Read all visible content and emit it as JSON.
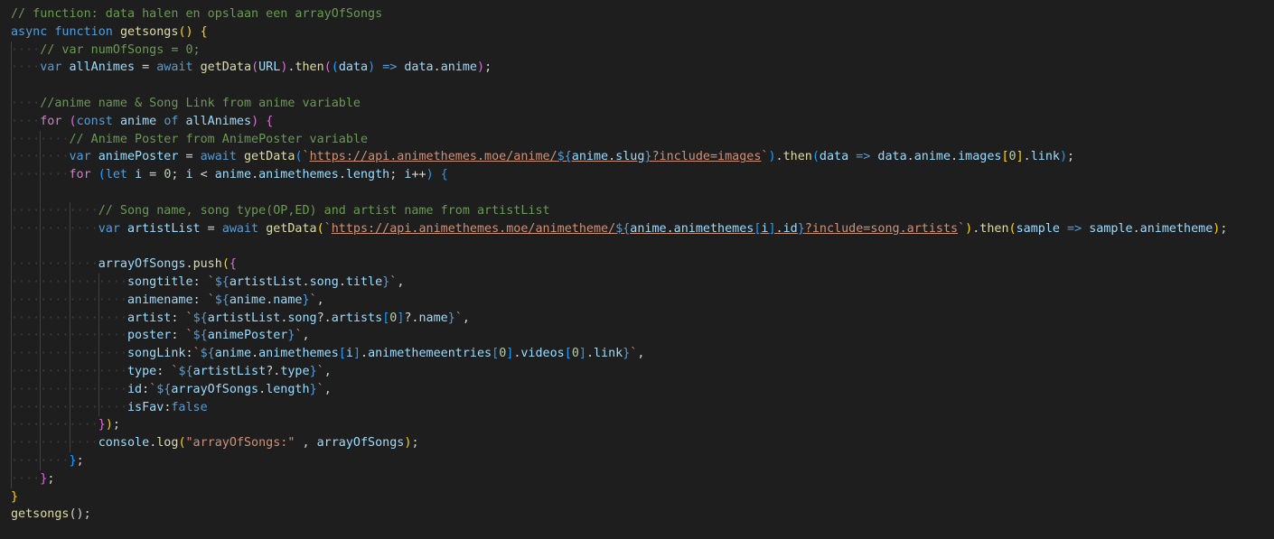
{
  "editor": {
    "lines": [
      [
        {
          "t": "// function: data halen en opslaan een arrayOfSongs",
          "c": "c"
        }
      ],
      [
        {
          "t": "async",
          "c": "k"
        },
        {
          "t": " "
        },
        {
          "t": "function",
          "c": "k"
        },
        {
          "t": " "
        },
        {
          "t": "getsongs",
          "c": "f"
        },
        {
          "t": "()",
          "c": "b1"
        },
        {
          "t": " "
        },
        {
          "t": "{",
          "c": "b1"
        }
      ],
      [
        {
          "t": "····",
          "c": "ws"
        },
        {
          "t": "// var numOfSongs = 0;",
          "c": "c"
        }
      ],
      [
        {
          "t": "····",
          "c": "ws"
        },
        {
          "t": "var",
          "c": "k"
        },
        {
          "t": " "
        },
        {
          "t": "allAnimes",
          "c": "v"
        },
        {
          "t": " = "
        },
        {
          "t": "await",
          "c": "k"
        },
        {
          "t": " "
        },
        {
          "t": "getData",
          "c": "f"
        },
        {
          "t": "(",
          "c": "b2"
        },
        {
          "t": "URL",
          "c": "v"
        },
        {
          "t": ")",
          "c": "b2"
        },
        {
          "t": "."
        },
        {
          "t": "then",
          "c": "f"
        },
        {
          "t": "(",
          "c": "b2"
        },
        {
          "t": "(",
          "c": "b3"
        },
        {
          "t": "data",
          "c": "v"
        },
        {
          "t": ")",
          "c": "b3"
        },
        {
          "t": " "
        },
        {
          "t": "=>",
          "c": "k"
        },
        {
          "t": " "
        },
        {
          "t": "data",
          "c": "v"
        },
        {
          "t": "."
        },
        {
          "t": "anime",
          "c": "v"
        },
        {
          "t": ")",
          "c": "b2"
        },
        {
          "t": ";"
        }
      ],
      [],
      [
        {
          "t": "····",
          "c": "ws"
        },
        {
          "t": "//anime name & Song Link from anime variable",
          "c": "c"
        }
      ],
      [
        {
          "t": "····",
          "c": "ws"
        },
        {
          "t": "for",
          "c": "k2"
        },
        {
          "t": " "
        },
        {
          "t": "(",
          "c": "b2"
        },
        {
          "t": "const",
          "c": "k"
        },
        {
          "t": " "
        },
        {
          "t": "anime",
          "c": "v"
        },
        {
          "t": " "
        },
        {
          "t": "of",
          "c": "k"
        },
        {
          "t": " "
        },
        {
          "t": "allAnimes",
          "c": "v"
        },
        {
          "t": ")",
          "c": "b2"
        },
        {
          "t": " "
        },
        {
          "t": "{",
          "c": "b2"
        }
      ],
      [
        {
          "t": "········",
          "c": "ws"
        },
        {
          "t": "// Anime Poster from AnimePoster variable",
          "c": "c"
        }
      ],
      [
        {
          "t": "········",
          "c": "ws"
        },
        {
          "t": "var",
          "c": "k"
        },
        {
          "t": " "
        },
        {
          "t": "animePoster",
          "c": "v"
        },
        {
          "t": " = "
        },
        {
          "t": "await",
          "c": "k"
        },
        {
          "t": " "
        },
        {
          "t": "getData",
          "c": "f"
        },
        {
          "t": "(",
          "c": "b3"
        },
        {
          "t": "`",
          "c": "s"
        },
        {
          "t": "https://api.animethemes.moe/anime/",
          "c": "s",
          "u": true
        },
        {
          "t": "${",
          "c": "k",
          "u": true
        },
        {
          "t": "anime",
          "c": "v",
          "u": true
        },
        {
          "t": ".",
          "c": "o",
          "u": true
        },
        {
          "t": "slug",
          "c": "v",
          "u": true
        },
        {
          "t": "}",
          "c": "k",
          "u": true
        },
        {
          "t": "?include=images",
          "c": "s",
          "u": true
        },
        {
          "t": "`",
          "c": "s"
        },
        {
          "t": ")",
          "c": "b3"
        },
        {
          "t": "."
        },
        {
          "t": "then",
          "c": "f"
        },
        {
          "t": "(",
          "c": "b3"
        },
        {
          "t": "data",
          "c": "v"
        },
        {
          "t": " "
        },
        {
          "t": "=>",
          "c": "k"
        },
        {
          "t": " "
        },
        {
          "t": "data",
          "c": "v"
        },
        {
          "t": "."
        },
        {
          "t": "anime",
          "c": "v"
        },
        {
          "t": "."
        },
        {
          "t": "images",
          "c": "v"
        },
        {
          "t": "[",
          "c": "b1"
        },
        {
          "t": "0",
          "c": "n"
        },
        {
          "t": "]",
          "c": "b1"
        },
        {
          "t": "."
        },
        {
          "t": "link",
          "c": "v"
        },
        {
          "t": ")",
          "c": "b3"
        },
        {
          "t": ";"
        }
      ],
      [
        {
          "t": "········",
          "c": "ws"
        },
        {
          "t": "for",
          "c": "k2"
        },
        {
          "t": " "
        },
        {
          "t": "(",
          "c": "b3"
        },
        {
          "t": "let",
          "c": "k"
        },
        {
          "t": " "
        },
        {
          "t": "i",
          "c": "v"
        },
        {
          "t": " = "
        },
        {
          "t": "0",
          "c": "n"
        },
        {
          "t": "; "
        },
        {
          "t": "i",
          "c": "v"
        },
        {
          "t": " < "
        },
        {
          "t": "anime",
          "c": "v"
        },
        {
          "t": "."
        },
        {
          "t": "animethemes",
          "c": "v"
        },
        {
          "t": "."
        },
        {
          "t": "length",
          "c": "v"
        },
        {
          "t": "; "
        },
        {
          "t": "i",
          "c": "v"
        },
        {
          "t": "++"
        },
        {
          "t": ")",
          "c": "b3"
        },
        {
          "t": " "
        },
        {
          "t": "{",
          "c": "b3"
        }
      ],
      [],
      [
        {
          "t": "············",
          "c": "ws"
        },
        {
          "t": "// Song name, song type(OP,ED) and artist name from artistList",
          "c": "c"
        }
      ],
      [
        {
          "t": "············",
          "c": "ws"
        },
        {
          "t": "var",
          "c": "k"
        },
        {
          "t": " "
        },
        {
          "t": "artistList",
          "c": "v"
        },
        {
          "t": " = "
        },
        {
          "t": "await",
          "c": "k"
        },
        {
          "t": " "
        },
        {
          "t": "getData",
          "c": "f"
        },
        {
          "t": "(",
          "c": "b1"
        },
        {
          "t": "`",
          "c": "s"
        },
        {
          "t": "https://api.animethemes.moe/animetheme/",
          "c": "s",
          "u": true
        },
        {
          "t": "${",
          "c": "k",
          "u": true
        },
        {
          "t": "anime",
          "c": "v",
          "u": true
        },
        {
          "t": ".",
          "c": "o",
          "u": true
        },
        {
          "t": "animethemes",
          "c": "v",
          "u": true
        },
        {
          "t": "[",
          "c": "b3",
          "u": true
        },
        {
          "t": "i",
          "c": "v",
          "u": true
        },
        {
          "t": "]",
          "c": "b3",
          "u": true
        },
        {
          "t": ".",
          "c": "o",
          "u": true
        },
        {
          "t": "id",
          "c": "v",
          "u": true
        },
        {
          "t": "}",
          "c": "k",
          "u": true
        },
        {
          "t": "?include=song.artists",
          "c": "s",
          "u": true
        },
        {
          "t": "`",
          "c": "s"
        },
        {
          "t": ")",
          "c": "b1"
        },
        {
          "t": "."
        },
        {
          "t": "then",
          "c": "f"
        },
        {
          "t": "(",
          "c": "b1"
        },
        {
          "t": "sample",
          "c": "v"
        },
        {
          "t": " "
        },
        {
          "t": "=>",
          "c": "k"
        },
        {
          "t": " "
        },
        {
          "t": "sample",
          "c": "v"
        },
        {
          "t": "."
        },
        {
          "t": "animetheme",
          "c": "v"
        },
        {
          "t": ")",
          "c": "b1"
        },
        {
          "t": ";"
        }
      ],
      [],
      [
        {
          "t": "············",
          "c": "ws"
        },
        {
          "t": "arrayOfSongs",
          "c": "v"
        },
        {
          "t": "."
        },
        {
          "t": "push",
          "c": "f"
        },
        {
          "t": "(",
          "c": "b1"
        },
        {
          "t": "{",
          "c": "b2"
        }
      ],
      [
        {
          "t": "················",
          "c": "ws"
        },
        {
          "t": "songtitle",
          "c": "v"
        },
        {
          "t": ": "
        },
        {
          "t": "`",
          "c": "s"
        },
        {
          "t": "${",
          "c": "k"
        },
        {
          "t": "artistList",
          "c": "v"
        },
        {
          "t": "."
        },
        {
          "t": "song",
          "c": "v"
        },
        {
          "t": "."
        },
        {
          "t": "title",
          "c": "v"
        },
        {
          "t": "}",
          "c": "k"
        },
        {
          "t": "`",
          "c": "s"
        },
        {
          "t": ","
        }
      ],
      [
        {
          "t": "················",
          "c": "ws"
        },
        {
          "t": "animename",
          "c": "v"
        },
        {
          "t": ": "
        },
        {
          "t": "`",
          "c": "s"
        },
        {
          "t": "${",
          "c": "k"
        },
        {
          "t": "anime",
          "c": "v"
        },
        {
          "t": "."
        },
        {
          "t": "name",
          "c": "v"
        },
        {
          "t": "}",
          "c": "k"
        },
        {
          "t": "`",
          "c": "s"
        },
        {
          "t": ","
        }
      ],
      [
        {
          "t": "················",
          "c": "ws"
        },
        {
          "t": "artist",
          "c": "v"
        },
        {
          "t": ": "
        },
        {
          "t": "`",
          "c": "s"
        },
        {
          "t": "${",
          "c": "k"
        },
        {
          "t": "artistList",
          "c": "v"
        },
        {
          "t": "."
        },
        {
          "t": "song",
          "c": "v"
        },
        {
          "t": "?."
        },
        {
          "t": "artists",
          "c": "v"
        },
        {
          "t": "[",
          "c": "b3"
        },
        {
          "t": "0",
          "c": "n"
        },
        {
          "t": "]",
          "c": "b3"
        },
        {
          "t": "?."
        },
        {
          "t": "name",
          "c": "v"
        },
        {
          "t": "}",
          "c": "k"
        },
        {
          "t": "`",
          "c": "s"
        },
        {
          "t": ","
        }
      ],
      [
        {
          "t": "················",
          "c": "ws"
        },
        {
          "t": "poster",
          "c": "v"
        },
        {
          "t": ": "
        },
        {
          "t": "`",
          "c": "s"
        },
        {
          "t": "${",
          "c": "k"
        },
        {
          "t": "animePoster",
          "c": "v"
        },
        {
          "t": "}",
          "c": "k"
        },
        {
          "t": "`",
          "c": "s"
        },
        {
          "t": ","
        }
      ],
      [
        {
          "t": "················",
          "c": "ws"
        },
        {
          "t": "songLink",
          "c": "v"
        },
        {
          "t": ":"
        },
        {
          "t": "`",
          "c": "s"
        },
        {
          "t": "${",
          "c": "k"
        },
        {
          "t": "anime",
          "c": "v"
        },
        {
          "t": "."
        },
        {
          "t": "animethemes",
          "c": "v"
        },
        {
          "t": "[",
          "c": "b3"
        },
        {
          "t": "i",
          "c": "v"
        },
        {
          "t": "]",
          "c": "b3"
        },
        {
          "t": "."
        },
        {
          "t": "animethemeentries",
          "c": "v"
        },
        {
          "t": "[",
          "c": "b3"
        },
        {
          "t": "0",
          "c": "n"
        },
        {
          "t": "]",
          "c": "b3"
        },
        {
          "t": "."
        },
        {
          "t": "videos",
          "c": "v"
        },
        {
          "t": "[",
          "c": "b3"
        },
        {
          "t": "0",
          "c": "n"
        },
        {
          "t": "]",
          "c": "b3"
        },
        {
          "t": "."
        },
        {
          "t": "link",
          "c": "v"
        },
        {
          "t": "}",
          "c": "k"
        },
        {
          "t": "`",
          "c": "s"
        },
        {
          "t": ","
        }
      ],
      [
        {
          "t": "················",
          "c": "ws"
        },
        {
          "t": "type",
          "c": "v"
        },
        {
          "t": ": "
        },
        {
          "t": "`",
          "c": "s"
        },
        {
          "t": "${",
          "c": "k"
        },
        {
          "t": "artistList",
          "c": "v"
        },
        {
          "t": "?."
        },
        {
          "t": "type",
          "c": "v"
        },
        {
          "t": "}",
          "c": "k"
        },
        {
          "t": "`",
          "c": "s"
        },
        {
          "t": ","
        }
      ],
      [
        {
          "t": "················",
          "c": "ws"
        },
        {
          "t": "id",
          "c": "v"
        },
        {
          "t": ":"
        },
        {
          "t": "`",
          "c": "s"
        },
        {
          "t": "${",
          "c": "k"
        },
        {
          "t": "arrayOfSongs",
          "c": "v"
        },
        {
          "t": "."
        },
        {
          "t": "length",
          "c": "v"
        },
        {
          "t": "}",
          "c": "k"
        },
        {
          "t": "`",
          "c": "s"
        },
        {
          "t": ","
        }
      ],
      [
        {
          "t": "················",
          "c": "ws"
        },
        {
          "t": "isFav",
          "c": "v"
        },
        {
          "t": ":"
        },
        {
          "t": "false",
          "c": "t"
        }
      ],
      [
        {
          "t": "············",
          "c": "ws"
        },
        {
          "t": "}",
          "c": "b2"
        },
        {
          "t": ")",
          "c": "b1"
        },
        {
          "t": ";"
        }
      ],
      [
        {
          "t": "············",
          "c": "ws"
        },
        {
          "t": "console",
          "c": "v"
        },
        {
          "t": "."
        },
        {
          "t": "log",
          "c": "f"
        },
        {
          "t": "(",
          "c": "b1"
        },
        {
          "t": "\"arrayOfSongs:\"",
          "c": "s"
        },
        {
          "t": " , "
        },
        {
          "t": "arrayOfSongs",
          "c": "v"
        },
        {
          "t": ")",
          "c": "b1"
        },
        {
          "t": ";"
        }
      ],
      [
        {
          "t": "········",
          "c": "ws"
        },
        {
          "t": "}",
          "c": "b3"
        },
        {
          "t": ";"
        }
      ],
      [
        {
          "t": "····",
          "c": "ws"
        },
        {
          "t": "}",
          "c": "b2"
        },
        {
          "t": ";"
        }
      ],
      [
        {
          "t": "}",
          "c": "b1"
        }
      ],
      [
        {
          "t": "getsongs",
          "c": "f"
        },
        {
          "t": "();"
        }
      ]
    ]
  }
}
